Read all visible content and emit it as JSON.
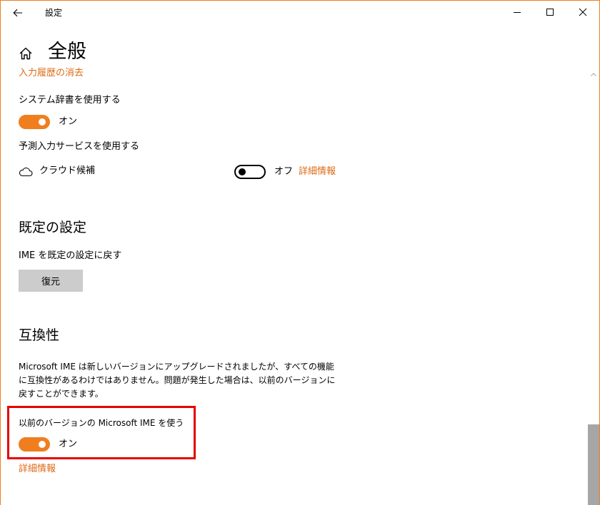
{
  "window": {
    "title": "設定",
    "accent_color": "#f07e1f",
    "link_color": "#de6a14",
    "highlight_color": "#e50000"
  },
  "header": {
    "page_title": "全般"
  },
  "input_history": {
    "clear_link": "入力履歴の消去"
  },
  "system_dictionary": {
    "label": "システム辞書を使用する",
    "toggle_state": "オン",
    "toggle_on": true
  },
  "predictive_input": {
    "label": "予測入力サービスを使用する",
    "cloud_label": "クラウド候補",
    "toggle_state": "オフ",
    "toggle_on": false,
    "details_link": "詳細情報"
  },
  "defaults": {
    "heading": "既定の設定",
    "label": "IME を既定の設定に戻す",
    "restore_button": "復元"
  },
  "compatibility": {
    "heading": "互換性",
    "description": "Microsoft IME は新しいバージョンにアップグレードされましたが、すべての機能に互換性があるわけではありません。問題が発生した場合は、以前のバージョンに戻すことができます。",
    "previous_version_label": "以前のバージョンの Microsoft IME を使う",
    "toggle_state": "オン",
    "toggle_on": true,
    "details_link": "詳細情報"
  }
}
